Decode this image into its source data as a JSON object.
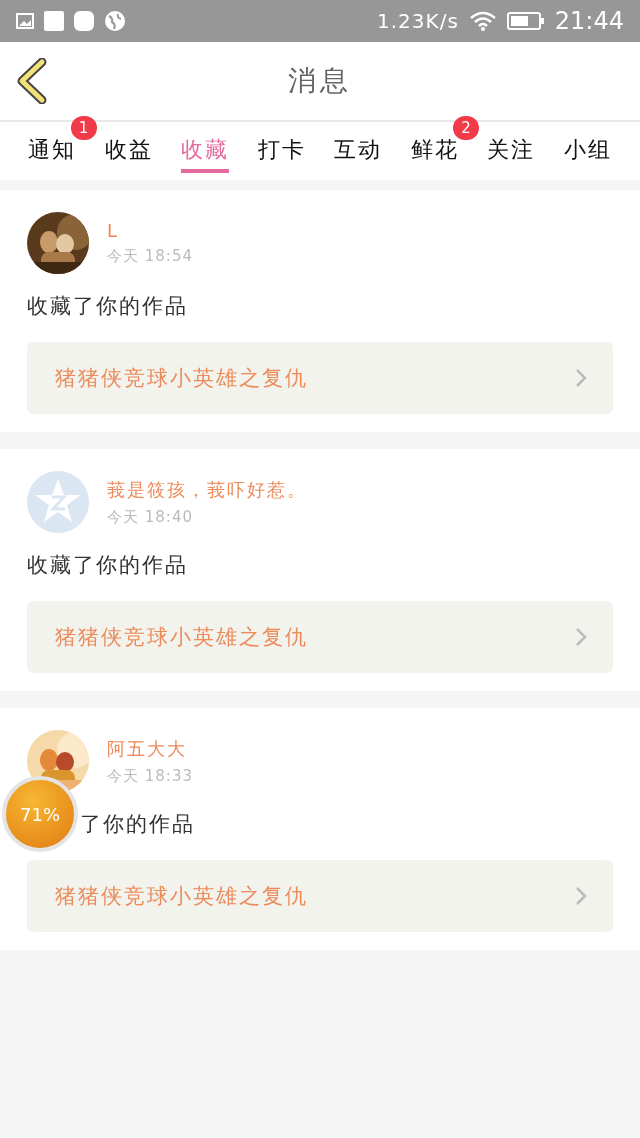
{
  "status_bar": {
    "speed": "1.23K/s",
    "time": "21:44"
  },
  "header": {
    "title": "消息"
  },
  "tabs": [
    {
      "label": "通知",
      "selected": false,
      "badge": "1"
    },
    {
      "label": "收益",
      "selected": false
    },
    {
      "label": "收藏",
      "selected": true
    },
    {
      "label": "打卡",
      "selected": false
    },
    {
      "label": "互动",
      "selected": false
    },
    {
      "label": "鲜花",
      "selected": false,
      "badge": "2"
    },
    {
      "label": "关注",
      "selected": false
    },
    {
      "label": "小组",
      "selected": false
    }
  ],
  "messages": [
    {
      "name": "L",
      "time": "今天 18:54",
      "action": "收藏了你的作品",
      "kind": "full",
      "work": "猪猪侠竞球小英雄之复仇"
    },
    {
      "avatar": {
        "kind": "default"
      },
      "name": "莪是筱孩，莪吓好惹。",
      "time": "今天 18:40",
      "action": "收藏了你的作品",
      "kind": "full",
      "work": "猪猪侠竞球小英雄之复仇"
    },
    {
      "name": "阿五大大",
      "time": "今天 18:33",
      "action": "了你的作品",
      "kind": "covered",
      "work": "猪猪侠竞球小英雄之复仇"
    }
  ],
  "floating_ball": {
    "label": "71%"
  }
}
